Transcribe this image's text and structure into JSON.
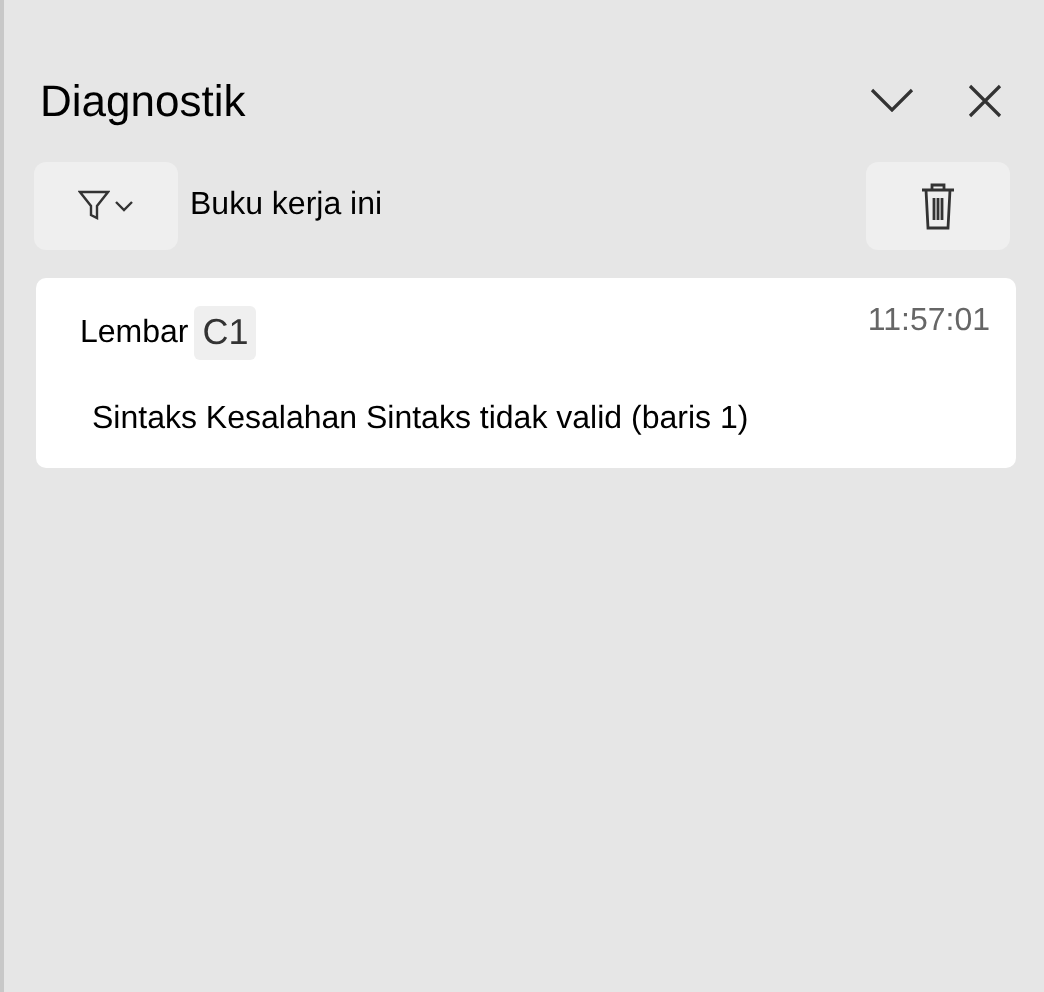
{
  "panel": {
    "title": "Diagnostik"
  },
  "toolbar": {
    "scope": "Buku kerja ini"
  },
  "entries": [
    {
      "sheet_label": "Lembar",
      "cell": "C1",
      "time": "11:57:01",
      "message": "Sintaks Kesalahan Sintaks tidak valid (baris 1)"
    }
  ]
}
